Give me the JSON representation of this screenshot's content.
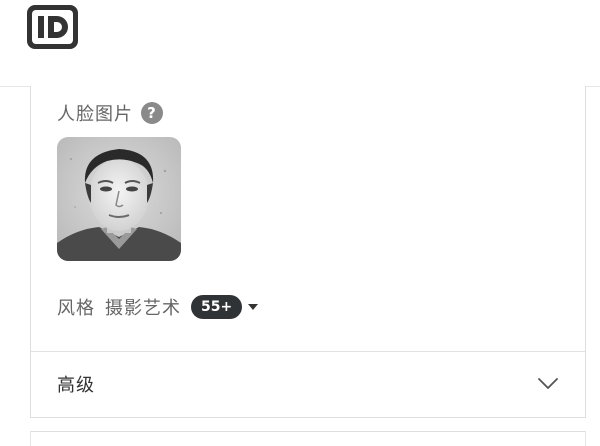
{
  "header": {
    "logo_icon": "id-logo-icon"
  },
  "face_section": {
    "label": "人脸图片",
    "help_icon_text": "?",
    "image_icon": "face-photo"
  },
  "style_row": {
    "label": "风格",
    "value": "摄影艺术",
    "badge": "55+",
    "dropdown_icon": "caret-down-icon"
  },
  "advanced": {
    "label": "高级",
    "toggle_icon": "chevron-down-icon"
  },
  "colors": {
    "badge_bg": "#2f3335",
    "logo": "#333333",
    "help_icon_bg": "#8a8a8a"
  }
}
